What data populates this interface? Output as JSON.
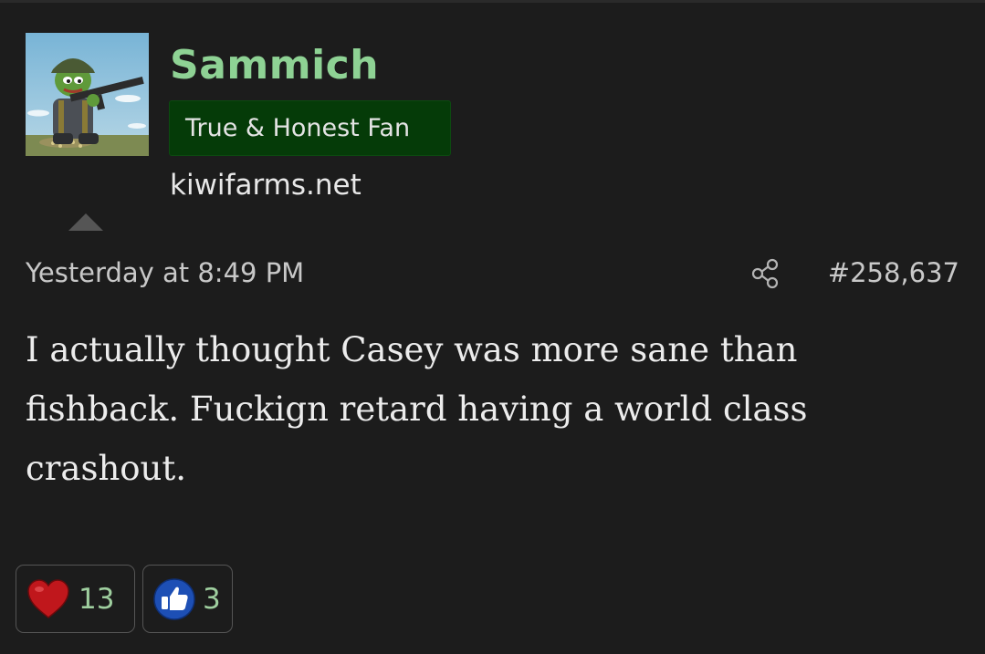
{
  "post": {
    "author": {
      "username": "Sammich",
      "role": "True & Honest Fan",
      "site": "kiwifarms.net"
    },
    "timestamp": "Yesterday at 8:49 PM",
    "post_number": "#258,637",
    "message_lines": [
      "I actually thought Casey was more sane than",
      "fishback. Fuckign retard having a world class",
      "crashout."
    ]
  },
  "reactions": [
    {
      "icon": "heart-icon",
      "count": "13"
    },
    {
      "icon": "thumbs-up-icon",
      "count": "3"
    }
  ],
  "colors": {
    "background": "#1c1c1c",
    "username": "#8ed294",
    "role_badge_bg": "#053b08",
    "reaction_count": "#9fcf9f",
    "heart": "#c0171c",
    "like": "#1d4fb5"
  }
}
